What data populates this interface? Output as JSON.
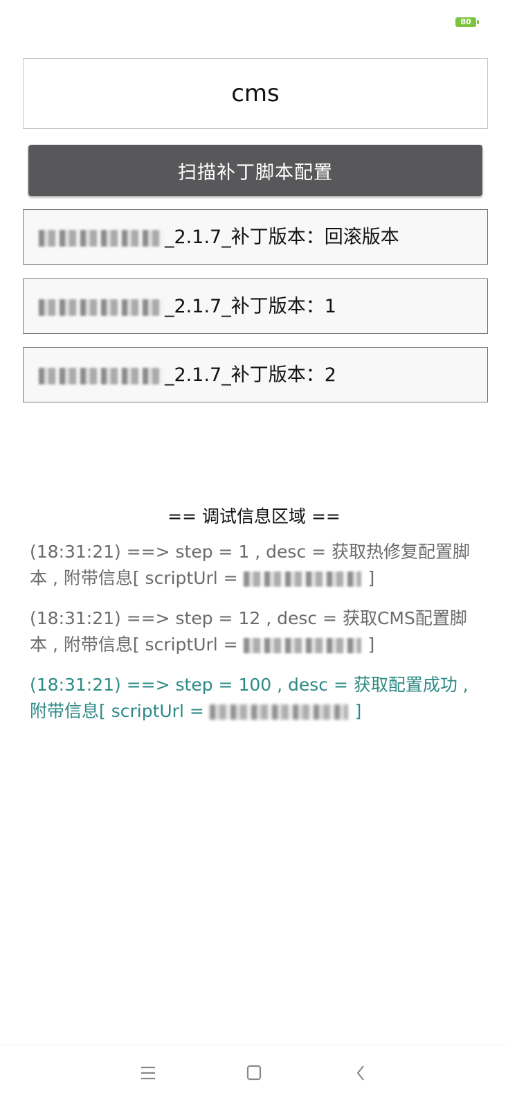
{
  "status_bar": {
    "battery_level": "80"
  },
  "search": {
    "value": "cms"
  },
  "scan_button": {
    "label": "扫描补丁脚本配置"
  },
  "patch_items": [
    {
      "label": "_2.1.7_补丁版本：回滚版本"
    },
    {
      "label": "_2.1.7_补丁版本：1"
    },
    {
      "label": "_2.1.7_补丁版本：2"
    }
  ],
  "debug": {
    "title": "== 调试信息区域 ==",
    "logs": [
      {
        "text": "(18:31:21) ==> step = 1 , desc = 获取热修复配置脚本 , 附带信息[ scriptUrl = ",
        "suffix": " ]"
      },
      {
        "text": "(18:31:21) ==> step = 12 , desc = 获取CMS配置脚本 , 附带信息[ scriptUrl = ",
        "suffix": " ]"
      },
      {
        "text": "(18:31:21) ==> step = 100 , desc = 获取配置成功 , 附带信息[ scriptUrl = ",
        "suffix": " ]"
      }
    ]
  },
  "colors": {
    "button_bg": "#58585a",
    "success_log": "#2d8a86",
    "battery": "#7cc33f"
  },
  "nav": {
    "menu_icon": "menu-icon",
    "home_icon": "home-icon",
    "back_icon": "back-icon"
  }
}
